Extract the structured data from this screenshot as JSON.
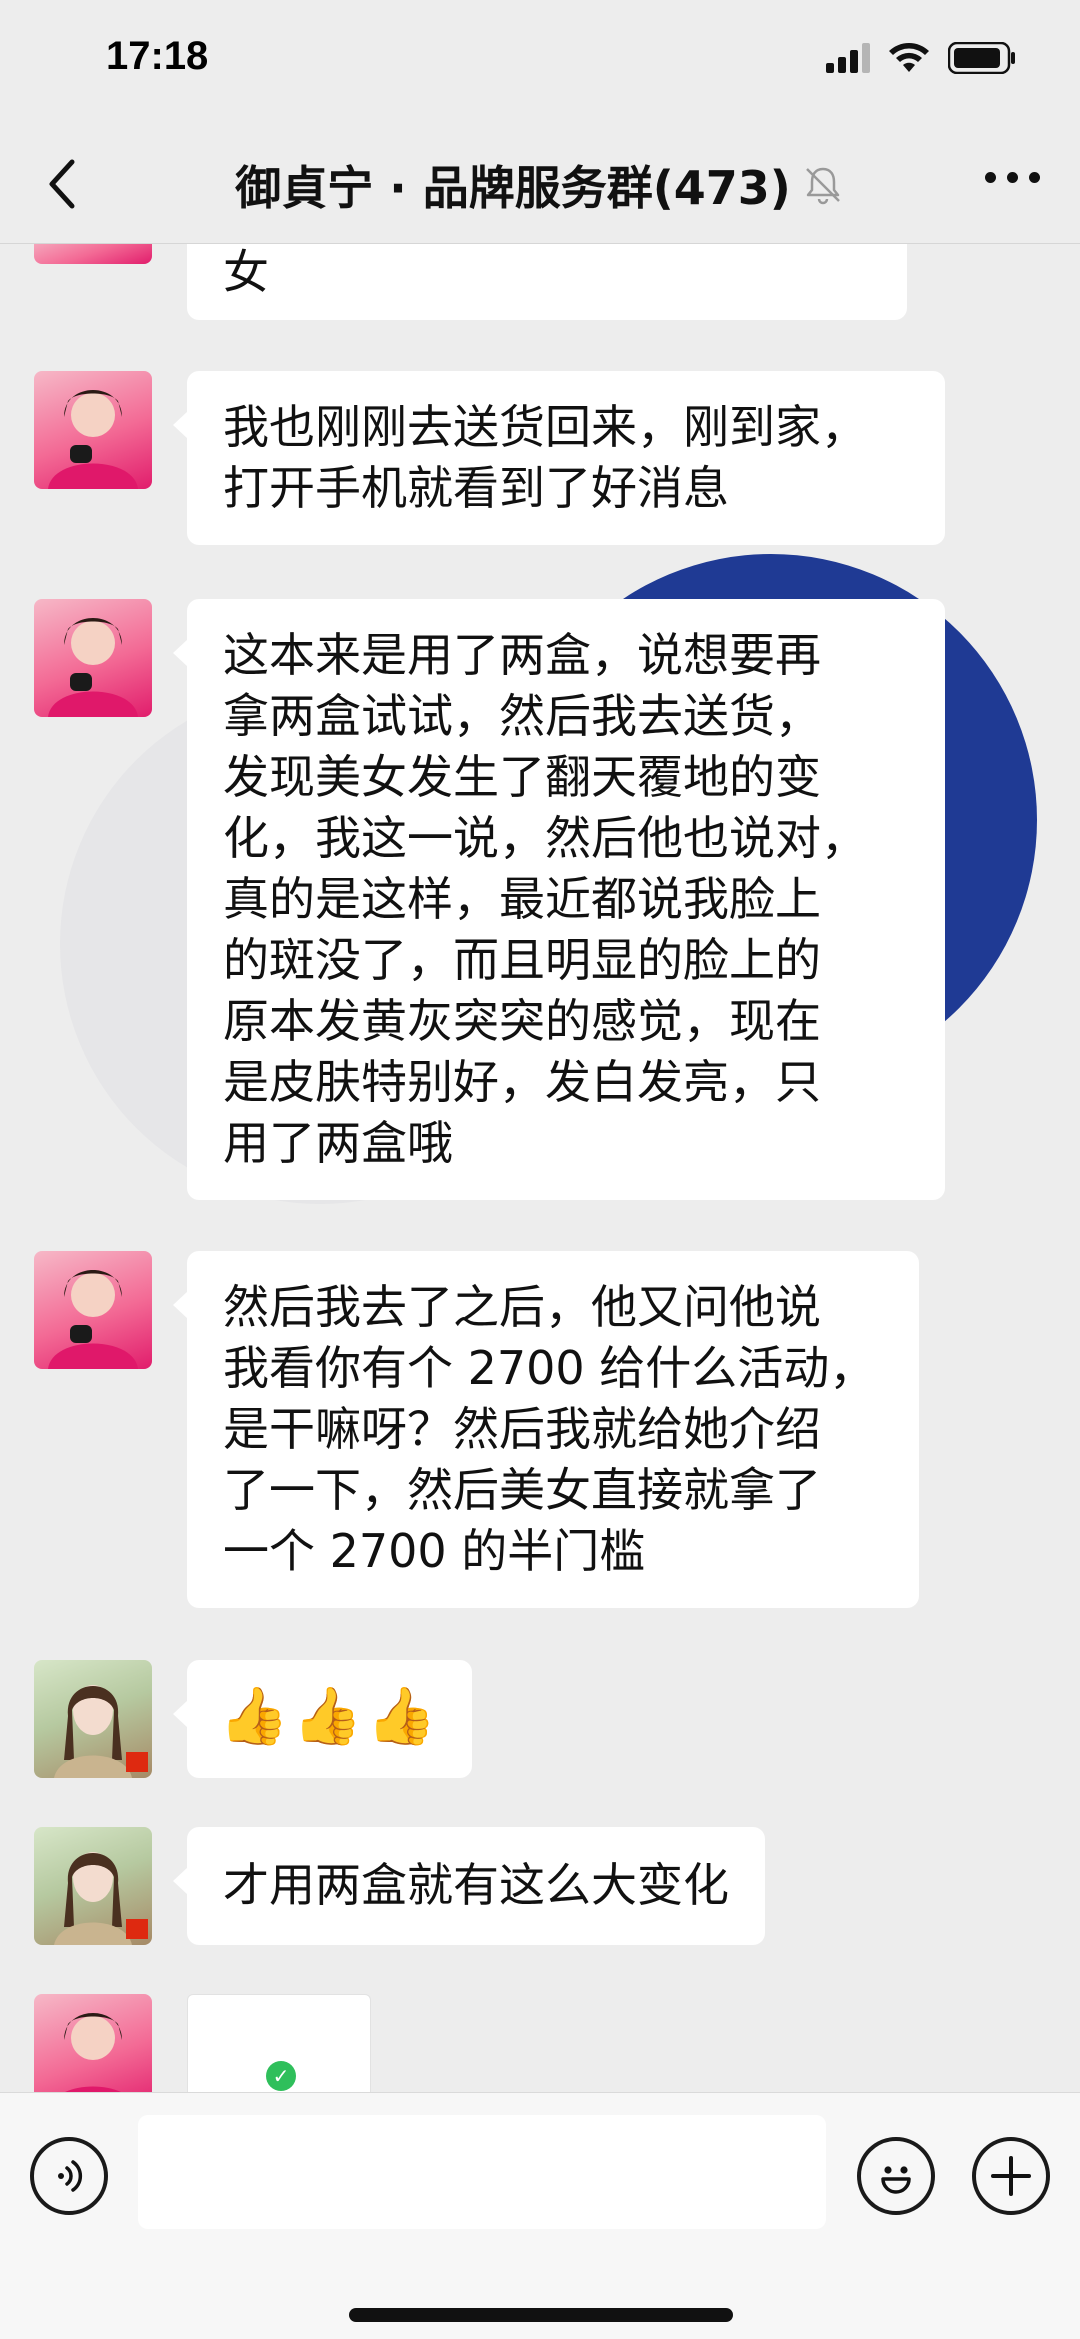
{
  "status_bar": {
    "time": "17:18",
    "icons": [
      "signal-icon",
      "wifi-icon",
      "battery-icon"
    ]
  },
  "nav": {
    "title": "御貞宁 · 品牌服务群(473)",
    "back_icon": "chevron-left-icon",
    "muted_icon": "bell-off-icon",
    "more_icon": "more-icon"
  },
  "messages": [
    {
      "sender_avatar": "avatar-a",
      "type": "text",
      "text": "女"
    },
    {
      "sender_avatar": "avatar-a",
      "type": "text",
      "text": "我也刚刚去送货回来，刚到家，\n打开手机就看到了好消息"
    },
    {
      "sender_avatar": "avatar-a",
      "type": "text",
      "text": "这本来是用了两盒，说想要再\n拿两盒试试，然后我去送货，\n发现美女发生了翻天覆地的变\n化，我这一说，然后他也说对，\n真的是这样，最近都说我脸上\n的斑没了，而且明显的脸上的\n原本发黄灰突突的感觉，现在\n是皮肤特别好，发白发亮，只\n用了两盒哦"
    },
    {
      "sender_avatar": "avatar-a",
      "type": "text",
      "text": "然后我去了之后，他又问他说\n我看你有个 2700 给什么活动，\n是干嘛呀？然后我就给她介绍\n了一下，然后美女直接就拿了\n一个 2700 的半门槛"
    },
    {
      "sender_avatar": "avatar-b",
      "type": "emoji",
      "text": "👍👍👍"
    },
    {
      "sender_avatar": "avatar-b",
      "type": "text",
      "text": "才用两盒就有这么大变化"
    },
    {
      "sender_avatar": "avatar-a",
      "type": "image",
      "icon": "check-icon"
    }
  ],
  "input_bar": {
    "voice_icon": "voice-icon",
    "emoji_icon": "emoji-icon",
    "add_icon": "plus-icon",
    "value": ""
  },
  "colors": {
    "background": "#ededed",
    "bubble": "#ffffff",
    "accent_blue": "#1f3a94"
  }
}
